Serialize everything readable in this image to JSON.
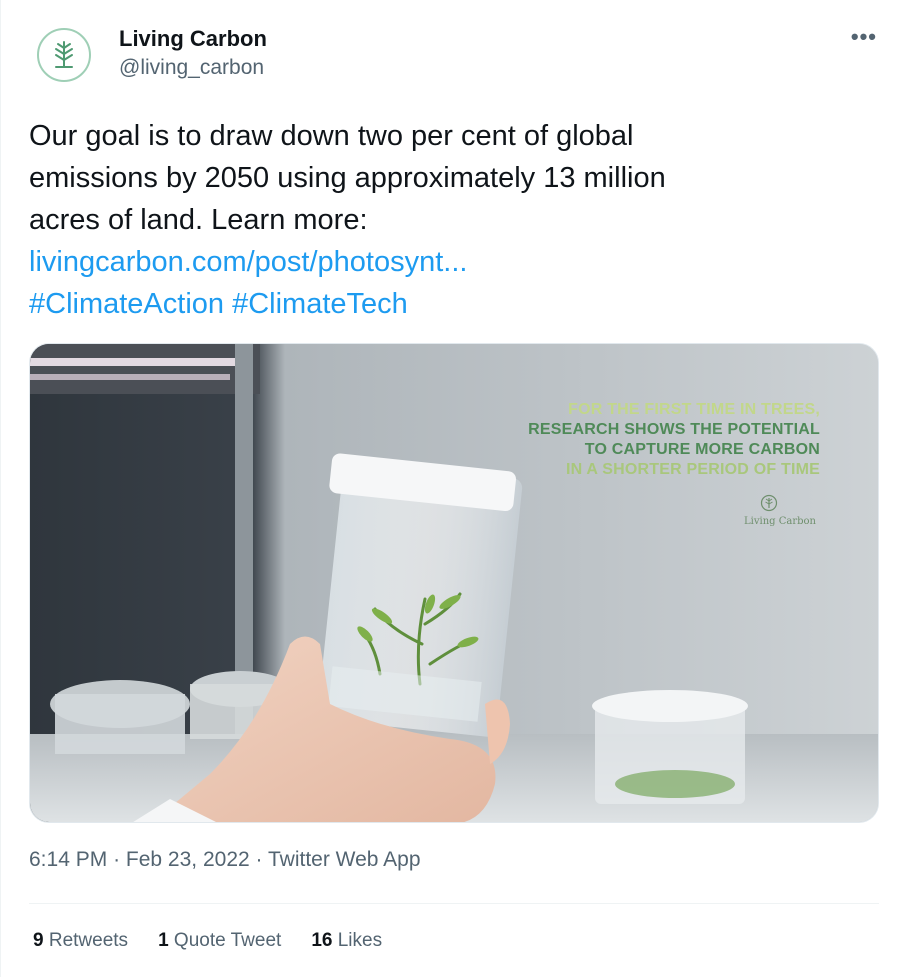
{
  "author": {
    "display_name": "Living Carbon",
    "handle": "@living_carbon",
    "avatar_icon": "tree-logo-icon",
    "brand_color": "#4f9a72"
  },
  "more_button": {
    "icon": "more-options-icon",
    "label": "•••"
  },
  "tweet": {
    "text_lines": [
      "Our goal is to draw down two per cent of global",
      "emissions by 2050 using approximately 13 million",
      "acres of land. Learn more:"
    ],
    "link": "livingcarbon.com/post/photosynt...",
    "hashtags": [
      "#ClimateAction",
      "#ClimateTech"
    ],
    "link_color": "#1d9bf0"
  },
  "media": {
    "overlay_lines": [
      "FOR THE FIRST TIME IN TREES,",
      "RESEARCH SHOWS THE POTENTIAL",
      "TO CAPTURE MORE CARBON",
      "IN A SHORTER PERIOD OF TIME"
    ],
    "brand_name": "Living Carbon"
  },
  "meta": {
    "time": "6:14 PM",
    "separator": "·",
    "date": "Feb 23, 2022",
    "source": "Twitter Web App"
  },
  "stats": {
    "retweets_count": "9",
    "retweets_label": "Retweets",
    "quotes_count": "1",
    "quotes_label": "Quote Tweet",
    "likes_count": "16",
    "likes_label": "Likes"
  }
}
